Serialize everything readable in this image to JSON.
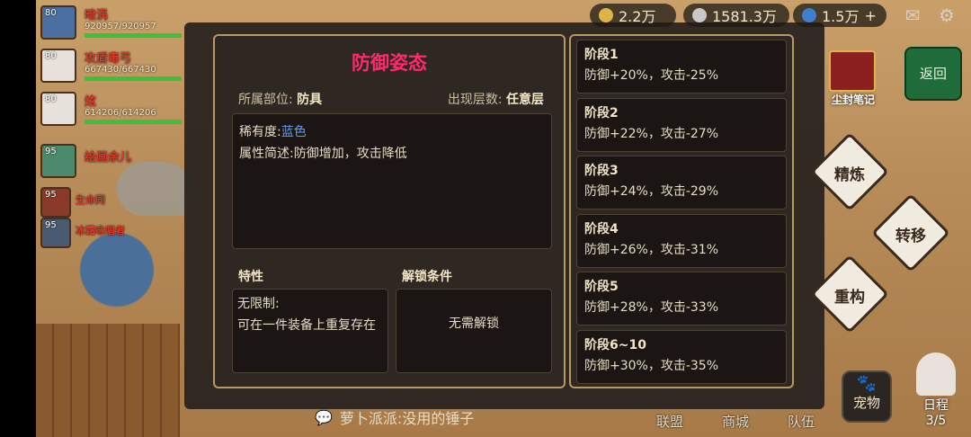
{
  "top_bar": {
    "gold": "2.2万",
    "silver": "1581.3万",
    "gems": "1.5万",
    "plus_glyph": "+",
    "mail_glyph": "✉",
    "settings_glyph": "⚙"
  },
  "party": [
    {
      "level": "80",
      "name": "暗涡",
      "hp": "920957/920957",
      "hp_ratio": 1.0
    },
    {
      "level": "80",
      "name": "攻盾毒弓",
      "hp": "667430/667430",
      "hp_ratio": 1.0
    },
    {
      "level": "80",
      "name": "炫",
      "hp": "614206/614206",
      "hp_ratio": 1.0
    },
    {
      "level": "95",
      "name": "绘画余儿",
      "hp": "",
      "hp_ratio": 0
    },
    {
      "level": "95",
      "name": "生命同",
      "hp": "",
      "hp_ratio": 0
    },
    {
      "level": "95",
      "name": "冰霜咏唱者",
      "hp": "",
      "hp_ratio": 0
    }
  ],
  "dialog": {
    "title": "防御姿态",
    "slot_label": "所属部位:",
    "slot_value": "防具",
    "floor_label": "出现层数:",
    "floor_value": "任意层",
    "rarity_label": "稀有度:",
    "rarity_value": "蓝色",
    "desc_label": "属性简述:",
    "desc_value": "防御增加，攻击降低",
    "trait_title": "特性",
    "trait_text_1": "无限制:",
    "trait_text_2": "可在一件装备上重复存在",
    "unlock_title": "解锁条件",
    "unlock_text": "无需解锁"
  },
  "stages": [
    {
      "name": "阶段1",
      "desc": "防御+20%，攻击-25%"
    },
    {
      "name": "阶段2",
      "desc": "防御+22%，攻击-27%"
    },
    {
      "name": "阶段3",
      "desc": "防御+24%，攻击-29%"
    },
    {
      "name": "阶段4",
      "desc": "防御+26%，攻击-31%"
    },
    {
      "name": "阶段5",
      "desc": "防御+28%，攻击-33%"
    },
    {
      "name": "阶段6~10",
      "desc": "防御+30%，攻击-35%"
    }
  ],
  "side": {
    "back": "返回",
    "seal_note": "尘封笔记",
    "refine": "精炼",
    "transfer": "转移",
    "rebuild": "重构"
  },
  "bottom": {
    "chat_text": "萝卜派派:没用的锤子",
    "chat_glyph": "💬",
    "alliance": "联盟",
    "shop": "商城",
    "team": "队伍",
    "pet": "宠物",
    "pet_glyph": "🐾",
    "schedule": "日程",
    "schedule_count": "3/5"
  }
}
